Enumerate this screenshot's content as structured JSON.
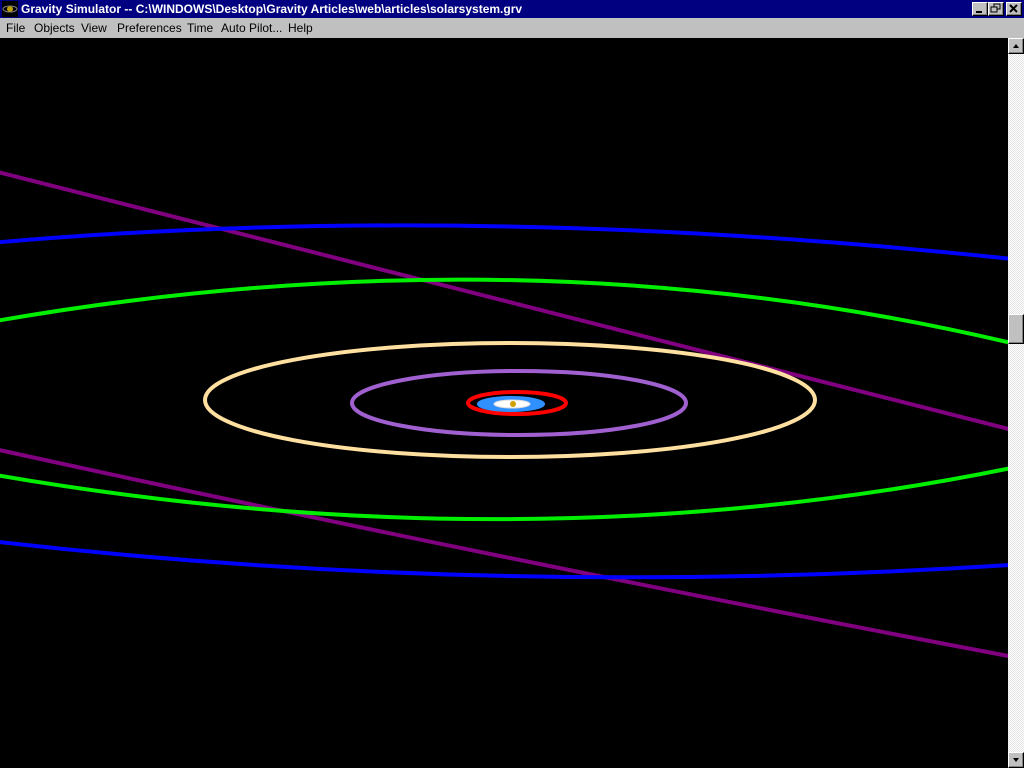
{
  "window": {
    "title": "Gravity Simulator -- C:\\WINDOWS\\Desktop\\Gravity Articles\\web\\articles\\solarsystem.grv"
  },
  "menu": {
    "items": [
      "File",
      "Objects",
      "View",
      "Preferences",
      "Time",
      "Auto Pilot...",
      "Help"
    ]
  },
  "simulation": {
    "background": "#000000",
    "orbits": [
      {
        "name": "pluto-orbit",
        "color": "#800080"
      },
      {
        "name": "neptune-orbit",
        "color": "#0000ff"
      },
      {
        "name": "uranus-orbit",
        "color": "#00ee00"
      },
      {
        "name": "saturn-orbit",
        "color": "#ffe0a0"
      },
      {
        "name": "jupiter-orbit",
        "color": "#a060d0"
      },
      {
        "name": "mars-orbit",
        "color": "#ff0000"
      },
      {
        "name": "earth-orbit",
        "color": "#3090ff"
      }
    ]
  }
}
